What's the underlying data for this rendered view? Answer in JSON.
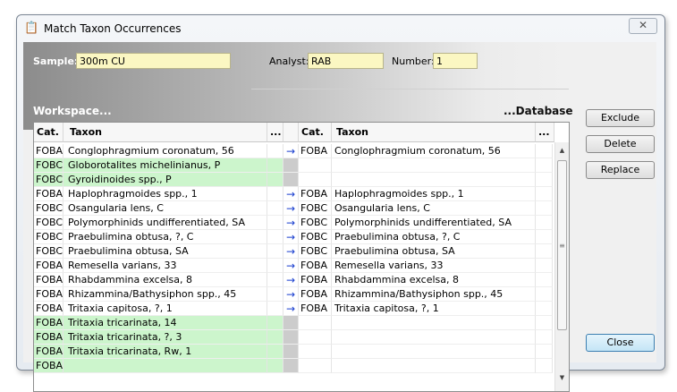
{
  "window": {
    "title": "Match Taxon Occurrences",
    "close_glyph": "✕"
  },
  "sample": {
    "label": "Sample:",
    "value": "300m CU"
  },
  "analyst": {
    "label": "Analyst:",
    "value": "RAB"
  },
  "number": {
    "label": "Number:",
    "value": "1"
  },
  "sections": {
    "workspace": "Workspace...",
    "database": "...Database"
  },
  "columns": {
    "cat": "Cat.",
    "taxon": "Taxon",
    "more": "..."
  },
  "rows": [
    {
      "ws_cat": "FOBA",
      "ws_taxon": "Conglophragmium coronatum, 56",
      "matched": true,
      "db_cat": "FOBA",
      "db_taxon": "Conglophragmium coronatum, 56",
      "ws_highlight": false
    },
    {
      "ws_cat": "FOBC",
      "ws_taxon": "Globorotalites michelinianus, P",
      "matched": false,
      "db_cat": "",
      "db_taxon": "",
      "ws_highlight": true
    },
    {
      "ws_cat": "FOBC",
      "ws_taxon": "Gyroidinoides spp., P",
      "matched": false,
      "db_cat": "",
      "db_taxon": "",
      "ws_highlight": true
    },
    {
      "ws_cat": "FOBA",
      "ws_taxon": "Haplophragmoides spp., 1",
      "matched": true,
      "db_cat": "FOBA",
      "db_taxon": "Haplophragmoides spp., 1",
      "ws_highlight": false
    },
    {
      "ws_cat": "FOBC",
      "ws_taxon": "Osangularia lens, C",
      "matched": true,
      "db_cat": "FOBC",
      "db_taxon": "Osangularia lens, C",
      "ws_highlight": false
    },
    {
      "ws_cat": "FOBC",
      "ws_taxon": "Polymorphinids undifferentiated, SA",
      "matched": true,
      "db_cat": "FOBC",
      "db_taxon": "Polymorphinids undifferentiated, SA",
      "ws_highlight": false
    },
    {
      "ws_cat": "FOBC",
      "ws_taxon": "Praebulimina obtusa, ?, C",
      "matched": true,
      "db_cat": "FOBC",
      "db_taxon": "Praebulimina obtusa, ?, C",
      "ws_highlight": false
    },
    {
      "ws_cat": "FOBC",
      "ws_taxon": "Praebulimina obtusa, SA",
      "matched": true,
      "db_cat": "FOBC",
      "db_taxon": "Praebulimina obtusa, SA",
      "ws_highlight": false
    },
    {
      "ws_cat": "FOBA",
      "ws_taxon": "Remesella varians, 33",
      "matched": true,
      "db_cat": "FOBA",
      "db_taxon": "Remesella varians, 33",
      "ws_highlight": false
    },
    {
      "ws_cat": "FOBA",
      "ws_taxon": "Rhabdammina excelsa, 8",
      "matched": true,
      "db_cat": "FOBA",
      "db_taxon": "Rhabdammina excelsa, 8",
      "ws_highlight": false
    },
    {
      "ws_cat": "FOBA",
      "ws_taxon": "Rhizammina/Bathysiphon spp., 45",
      "matched": true,
      "db_cat": "FOBA",
      "db_taxon": "Rhizammina/Bathysiphon spp., 45",
      "ws_highlight": false
    },
    {
      "ws_cat": "FOBA",
      "ws_taxon": "Tritaxia capitosa, ?, 1",
      "matched": true,
      "db_cat": "FOBA",
      "db_taxon": "Tritaxia capitosa, ?, 1",
      "ws_highlight": false
    },
    {
      "ws_cat": "FOBA",
      "ws_taxon": "Tritaxia tricarinata, 14",
      "matched": false,
      "db_cat": "",
      "db_taxon": "",
      "ws_highlight": true
    },
    {
      "ws_cat": "FOBA",
      "ws_taxon": "Tritaxia tricarinata, ?, 3",
      "matched": false,
      "db_cat": "",
      "db_taxon": "",
      "ws_highlight": true
    },
    {
      "ws_cat": "FOBA",
      "ws_taxon": "Tritaxia tricarinata, Rw, 1",
      "matched": false,
      "db_cat": "",
      "db_taxon": "",
      "ws_highlight": true
    },
    {
      "ws_cat": "FOBA",
      "ws_taxon": "",
      "matched": false,
      "db_cat": "",
      "db_taxon": "",
      "ws_highlight": true
    }
  ],
  "match_arrow": "→",
  "scrollbar": {
    "up": "▲",
    "down": "▼",
    "grip": "≡"
  },
  "buttons": {
    "exclude": "Exclude",
    "delete": "Delete",
    "replace": "Replace",
    "close": "Close"
  },
  "colors": {
    "unmatched_row": "#ccf5cc",
    "field_bg": "#fbf7c2",
    "arrow": "#1a3fcf"
  }
}
